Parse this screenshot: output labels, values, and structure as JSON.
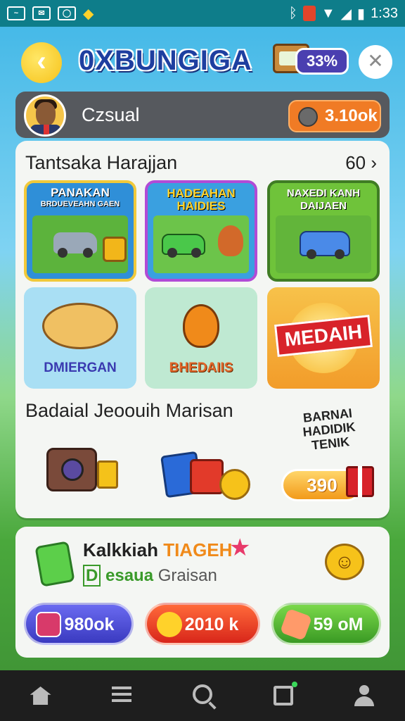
{
  "status_bar": {
    "time": "1:33"
  },
  "header": {
    "title": "0XBUNGIGA",
    "progress_label": "33%"
  },
  "user": {
    "name": "Czsual",
    "coins": "3.10ok"
  },
  "categories": {
    "title": "Tantsaka Harajjan",
    "see_all": "60",
    "tiles": [
      {
        "label": "PANAKAN",
        "sublabel": "BRDUEVEAHN GAEN"
      },
      {
        "label": "HADEAHAN HAIDIES"
      },
      {
        "label": "NAXEDI KANH DAIJAEN"
      },
      {
        "label": "DMIERGAN"
      },
      {
        "label": "BHEDAIIS"
      },
      {
        "label": "MEDAIH"
      }
    ]
  },
  "rewards_section": {
    "title": "Badaial Jeoouih Marisan",
    "promo_text": "BARNAI HADIDIK TENIK",
    "promo_value": "390"
  },
  "reward_card": {
    "title": "Kalkkiah",
    "title_highlight": "TIAGEH",
    "badge": "D",
    "subtitle_highlight": "esaua",
    "subtitle": "Graisan",
    "buttons": [
      "980ok",
      "2010 k",
      "59 oM"
    ]
  },
  "colors": {
    "accent": "#1e3fa0",
    "coin_pill": "#f07b25",
    "status_bar": "#0e7d8a"
  }
}
